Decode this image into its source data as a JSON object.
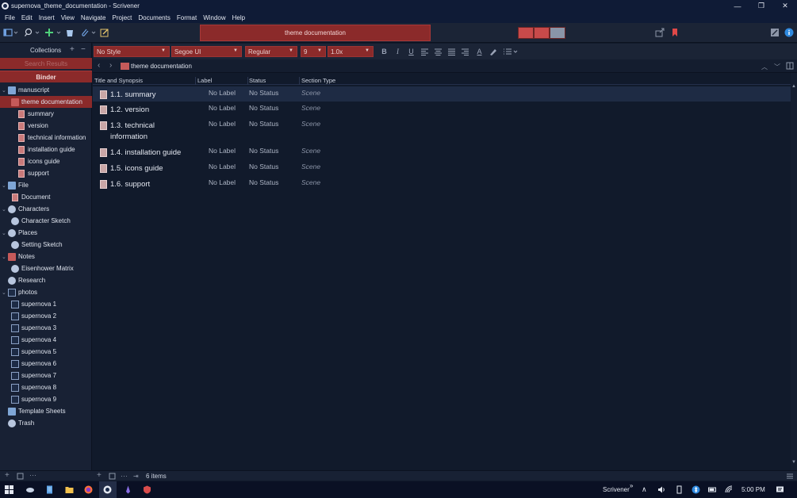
{
  "window": {
    "title": "supernova_theme_documentation - Scrivener",
    "controls": [
      "—",
      "❐",
      "✕"
    ]
  },
  "menu": [
    "File",
    "Edit",
    "Insert",
    "View",
    "Navigate",
    "Project",
    "Documents",
    "Format",
    "Window",
    "Help"
  ],
  "toolbar": {
    "document_title": "theme documentation"
  },
  "binder": {
    "collections_label": "Collections",
    "search_results_label": "Search Results",
    "binder_tab": "Binder",
    "items": [
      {
        "label": "manuscript",
        "icon": "folder-stack-icon",
        "depth": 0,
        "expanded": true
      },
      {
        "label": "theme documentation",
        "icon": "folder-icon",
        "depth": 1,
        "selected": true
      },
      {
        "label": "summary",
        "icon": "document-icon",
        "depth": 2
      },
      {
        "label": "version",
        "icon": "document-icon",
        "depth": 2
      },
      {
        "label": "technical information",
        "icon": "document-icon",
        "depth": 2
      },
      {
        "label": "installation guide",
        "icon": "document-icon",
        "depth": 2
      },
      {
        "label": "icons guide",
        "icon": "document-icon",
        "depth": 2
      },
      {
        "label": "support",
        "icon": "document-icon",
        "depth": 2
      },
      {
        "label": "File",
        "icon": "folder-icon",
        "depth": 0,
        "expanded": true
      },
      {
        "label": "Document",
        "icon": "document-icon",
        "depth": 1
      },
      {
        "label": "Characters",
        "icon": "person-icon",
        "depth": 0,
        "expanded": true
      },
      {
        "label": "Character Sketch",
        "icon": "character-sketch-icon",
        "depth": 1
      },
      {
        "label": "Places",
        "icon": "map-icon",
        "depth": 0,
        "expanded": true
      },
      {
        "label": "Setting Sketch",
        "icon": "setting-sketch-icon",
        "depth": 1
      },
      {
        "label": "Notes",
        "icon": "notebook-icon",
        "depth": 0,
        "expanded": true
      },
      {
        "label": "Eisenhower Matrix",
        "icon": "magnifier-icon",
        "depth": 1
      },
      {
        "label": "Research",
        "icon": "research-icon",
        "depth": 0
      },
      {
        "label": "photos",
        "icon": "photos-icon",
        "depth": 0,
        "expanded": true
      },
      {
        "label": "supernova 1",
        "icon": "image-icon",
        "depth": 1
      },
      {
        "label": "supernova 2",
        "icon": "image-icon",
        "depth": 1
      },
      {
        "label": "supernova 3",
        "icon": "image-icon",
        "depth": 1
      },
      {
        "label": "supernova 4",
        "icon": "image-icon",
        "depth": 1
      },
      {
        "label": "supernova 5",
        "icon": "image-icon",
        "depth": 1
      },
      {
        "label": "supernova 6",
        "icon": "image-icon",
        "depth": 1
      },
      {
        "label": "supernova 7",
        "icon": "image-icon",
        "depth": 1
      },
      {
        "label": "supernova 8",
        "icon": "image-icon",
        "depth": 1
      },
      {
        "label": "supernova 9",
        "icon": "image-icon",
        "depth": 1
      },
      {
        "label": "Template Sheets",
        "icon": "template-icon",
        "depth": 0
      },
      {
        "label": "Trash",
        "icon": "trash-icon",
        "depth": 0
      }
    ]
  },
  "format_bar": {
    "style": "No Style",
    "font": "Segoe UI",
    "weight": "Regular",
    "size": "9",
    "line_spacing": "1.0x"
  },
  "path_bar": {
    "crumb": "theme documentation"
  },
  "outliner": {
    "columns": [
      "Title and Synopsis",
      "Label",
      "Status",
      "Section Type"
    ],
    "rows": [
      {
        "title": "1.1. summary",
        "label": "No Label",
        "status": "No Status",
        "section": "Scene",
        "selected": true
      },
      {
        "title": "1.2. version",
        "label": "No Label",
        "status": "No Status",
        "section": "Scene"
      },
      {
        "title": "1.3. technical information",
        "label": "No Label",
        "status": "No Status",
        "section": "Scene"
      },
      {
        "title": "1.4. installation guide",
        "label": "No Label",
        "status": "No Status",
        "section": "Scene"
      },
      {
        "title": "1.5. icons guide",
        "label": "No Label",
        "status": "No Status",
        "section": "Scene"
      },
      {
        "title": "1.6. support",
        "label": "No Label",
        "status": "No Status",
        "section": "Scene"
      }
    ]
  },
  "footer": {
    "item_count": "6 items"
  },
  "taskbar": {
    "app_label": "Scrivener",
    "chevron": "»",
    "time": "5:00 PM"
  },
  "colors": {
    "accent": "#8b2a2a",
    "background": "#111a2b",
    "panel": "#182134"
  }
}
